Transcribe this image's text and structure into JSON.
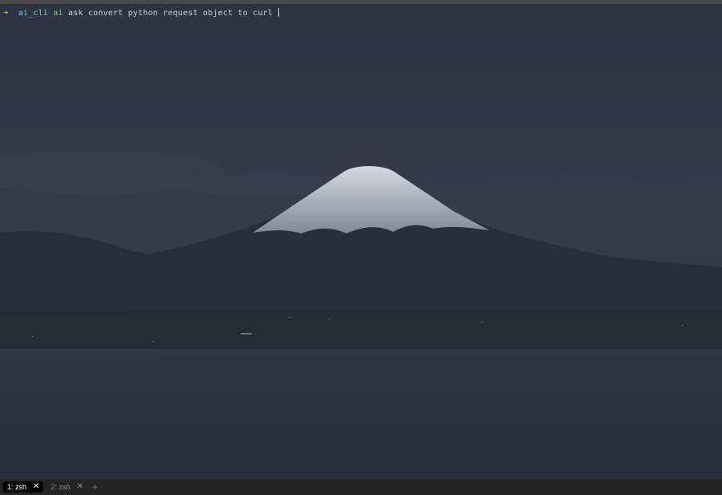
{
  "terminal": {
    "prompt_symbol": "➜",
    "directory": "ai_cli",
    "command": "ai",
    "arguments": "ask convert python request object to curl"
  },
  "tabs": [
    {
      "label": "1: zsh",
      "active": true,
      "close_icon": "close-icon"
    },
    {
      "label": "2: zsh",
      "active": false,
      "close_icon": "close-icon"
    }
  ],
  "new_tab_symbol": "+",
  "wallpaper": {
    "subject": "mount-fuji-dusk",
    "sky_color": "#2f3443",
    "mountain_color": "#2a2e3b",
    "snow_color": "#d8dce4",
    "water_color": "#2d3140"
  },
  "colors": {
    "prompt_arrow": "#c8c02a",
    "directory": "#7cc7e0",
    "command": "#6fd16f",
    "text": "#cfd3dc",
    "tab_bar": "#252525",
    "active_tab": "#000000"
  }
}
